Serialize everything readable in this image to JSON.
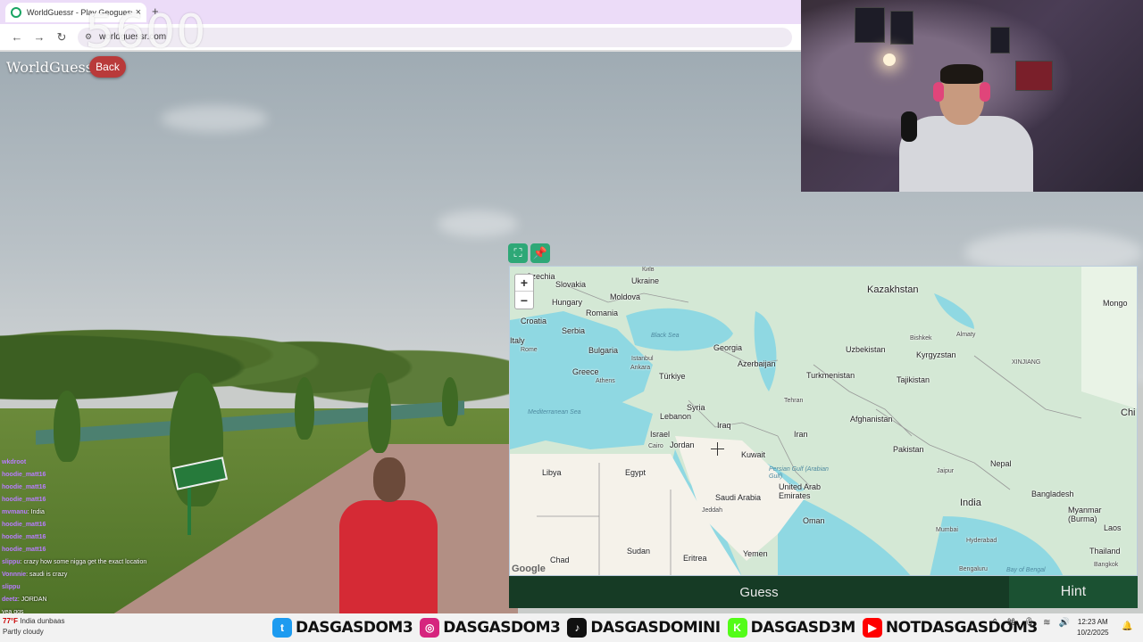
{
  "browser": {
    "tab_title": "WorldGuessr - Play Geoguessr",
    "tab_close": "×",
    "new_tab": "+",
    "url": "worldguessr.com",
    "nav_back": "←",
    "nav_forward": "→",
    "nav_reload": "↻"
  },
  "game": {
    "score": "5600",
    "brand": "WorldGuessr",
    "back_label": "Back",
    "guess_label": "Guess",
    "hint_label": "Hint",
    "zoom_in": "+",
    "zoom_out": "−",
    "map_attribution": "Google"
  },
  "map_labels": {
    "countries": [
      "Kazakhstan",
      "Ukraine",
      "Slovakia",
      "Hungary",
      "Moldova",
      "Romania",
      "Croatia",
      "Serbia",
      "Italy",
      "Bulgaria",
      "Georgia",
      "Azerbaijan",
      "Uzbekistan",
      "Kyrgyzstan",
      "Greece",
      "Türkiye",
      "Turkmenistan",
      "Tajikistan",
      "Syria",
      "Lebanon",
      "Iraq",
      "Afghanistan",
      "Israel",
      "Jordan",
      "Iran",
      "Kuwait",
      "Pakistan",
      "Libya",
      "Egypt",
      "Nepal",
      "United Arab Emirates",
      "Saudi Arabia",
      "Bangladesh",
      "India",
      "Myanmar (Burma)",
      "Oman",
      "Sudan",
      "Chad",
      "Eritrea",
      "Yemen",
      "Thailand",
      "Laos",
      "Mongo",
      "Chi",
      "Czechia"
    ],
    "seas": [
      "Black Sea",
      "Mediterranean Sea",
      "Persian Gulf (Arabian Gulf)",
      "Bay of Bengal"
    ],
    "cities": [
      "Київ",
      "Rome",
      "Istanbul",
      "Ankara",
      "Athens",
      "Tehran",
      "Cairo",
      "Jeddah",
      "Bishkek",
      "Almaty",
      "Jaipur",
      "Mumbai",
      "Hyderabad",
      "Bangkok",
      "Bengaluru",
      "XINJIANG"
    ]
  },
  "chat": [
    {
      "user": "wkdroot",
      "msg": ""
    },
    {
      "user": "hoodie_matt16",
      "msg": ""
    },
    {
      "user": "hoodie_matt16",
      "msg": ""
    },
    {
      "user": "hoodie_matt16",
      "msg": ""
    },
    {
      "user": "mvmanu",
      "msg": ": India"
    },
    {
      "user": "hoodie_matt16",
      "msg": ""
    },
    {
      "user": "hoodie_matt16",
      "msg": ""
    },
    {
      "user": "hoodie_matt16",
      "msg": ""
    },
    {
      "user": "slippu",
      "msg": ": crazy how some nigga get the exact location"
    },
    {
      "user": "Vonnnie",
      "msg": ": saudi is crazy"
    },
    {
      "user": "slippu",
      "msg": ""
    },
    {
      "user": "deetz",
      "msg": ": JORDAN"
    },
    {
      "user": "",
      "msg": "yea ggs"
    }
  ],
  "taskbar": {
    "weather_temp": "77°F",
    "weather_desc": "Partly cloudy",
    "ticker_line": "India dunbaas",
    "time": "12:23 AM",
    "date": "10/2/2025"
  },
  "socials": [
    {
      "icon": "twitter-icon",
      "color": "#1d9bf0",
      "glyph": "t",
      "label": "DASGASDOM3"
    },
    {
      "icon": "instagram-icon",
      "color": "#d6247e",
      "glyph": "◎",
      "label": "DASGASDOM3"
    },
    {
      "icon": "tiktok-icon",
      "color": "#111111",
      "glyph": "♪",
      "label": "DASGASDOMINI"
    },
    {
      "icon": "kick-icon",
      "color": "#53fc18",
      "glyph": "K",
      "label": "DASGASD3M"
    },
    {
      "icon": "youtube-icon",
      "color": "#ff0000",
      "glyph": "▶",
      "label": "NOTDASGASDOM3"
    }
  ],
  "colors": {
    "accent_green": "#2ea877",
    "guess_bg": "#163b25",
    "hint_bg": "#1b5132",
    "back_red": "#b93a3a"
  }
}
